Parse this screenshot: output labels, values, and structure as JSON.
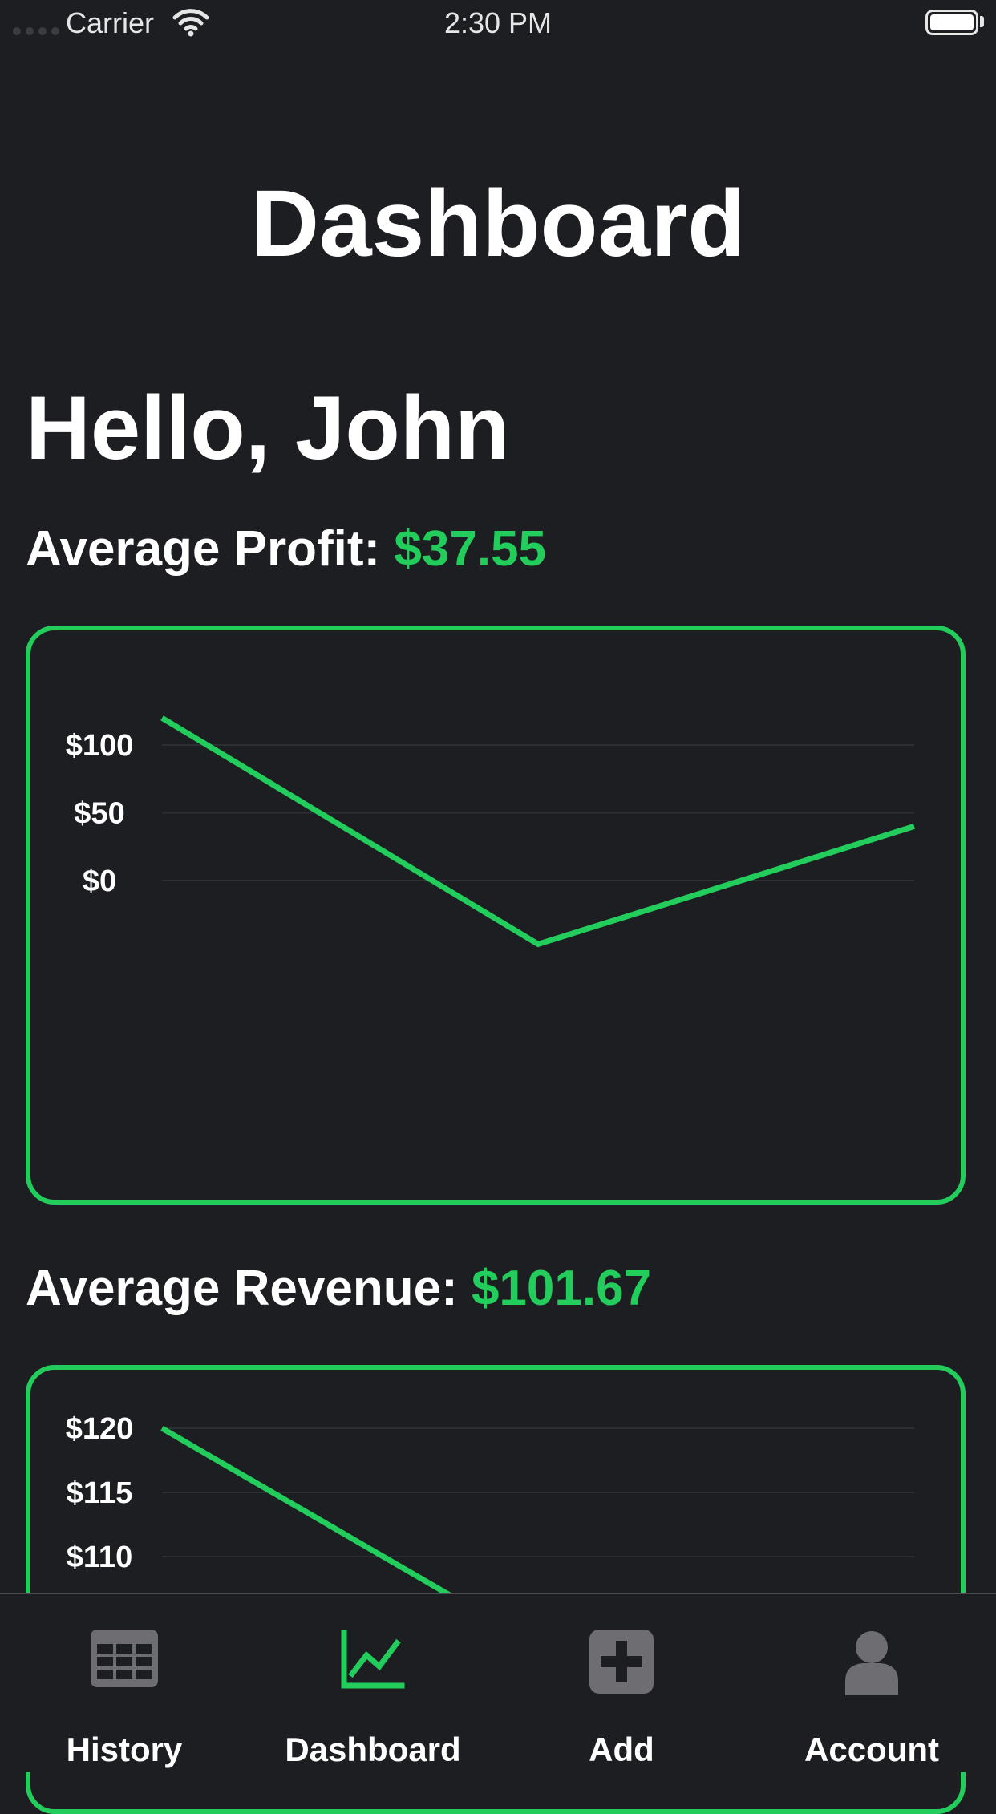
{
  "status_bar": {
    "carrier": "Carrier",
    "time": "2:30 PM"
  },
  "header": {
    "title": "Dashboard"
  },
  "greeting": "Hello, John",
  "metrics": {
    "profit": {
      "label": "Average Profit:",
      "value": "$37.55"
    },
    "revenue": {
      "label": "Average Revenue:",
      "value": "$101.67"
    }
  },
  "chart_data": [
    {
      "type": "line",
      "title": "",
      "y_ticks": [
        "$100",
        "$50",
        "$0"
      ],
      "ylim": [
        -47,
        120
      ],
      "x": [
        1,
        2,
        3
      ],
      "series": [
        {
          "values": [
            120,
            -47,
            40
          ]
        }
      ],
      "color": "#22cd5c",
      "grid": true
    },
    {
      "type": "line",
      "title": "",
      "y_ticks": [
        "$120",
        "$115",
        "$110"
      ],
      "x": [
        1,
        2,
        3
      ],
      "series": [
        {
          "values": [
            120,
            103
          ]
        }
      ],
      "color": "#22cd5c",
      "grid": true
    }
  ],
  "tabs": [
    {
      "label": "History",
      "icon": "table-icon",
      "active": false
    },
    {
      "label": "Dashboard",
      "icon": "chart-line-icon",
      "active": true
    },
    {
      "label": "Add",
      "icon": "plus-square-icon",
      "active": false
    },
    {
      "label": "Account",
      "icon": "person-icon",
      "active": false
    }
  ],
  "colors": {
    "accent": "#22cd5c",
    "background": "#1c1e22",
    "inactive_icon": "#6e6e72"
  }
}
